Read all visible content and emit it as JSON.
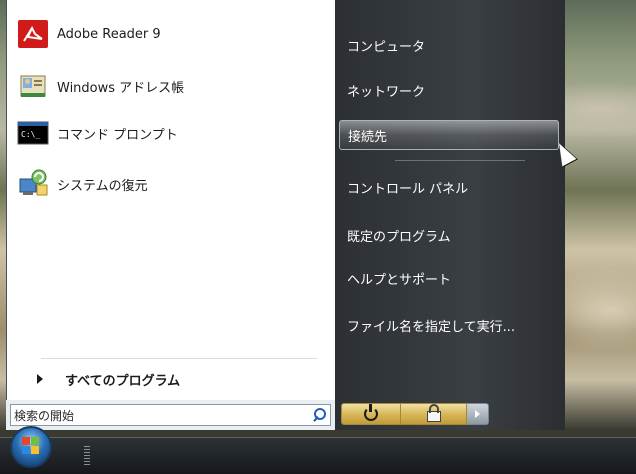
{
  "programs": [
    {
      "label": "Adobe Reader 9",
      "icon": "adobe-reader-icon"
    },
    {
      "label": "Windows アドレス帳",
      "icon": "address-book-icon"
    },
    {
      "label": "コマンド プロンプト",
      "icon": "command-prompt-icon"
    },
    {
      "label": "システムの復元",
      "icon": "system-restore-icon"
    }
  ],
  "all_programs": "すべてのプログラム",
  "search": {
    "placeholder": "検索の開始"
  },
  "right_menu": [
    {
      "label": "コンピュータ"
    },
    {
      "label": "ネットワーク"
    },
    {
      "label": "接続先"
    },
    {
      "label": "コントロール パネル"
    },
    {
      "label": "既定のプログラム"
    },
    {
      "label": "ヘルプとサポート"
    },
    {
      "label": "ファイル名を指定して実行..."
    }
  ],
  "power": {
    "power_icon": "power-icon",
    "lock_icon": "lock-icon",
    "arrow_icon": "arrow-right-icon"
  },
  "colors": {
    "accent_power": "#d9b85a",
    "menu_text": "#ffffff"
  }
}
